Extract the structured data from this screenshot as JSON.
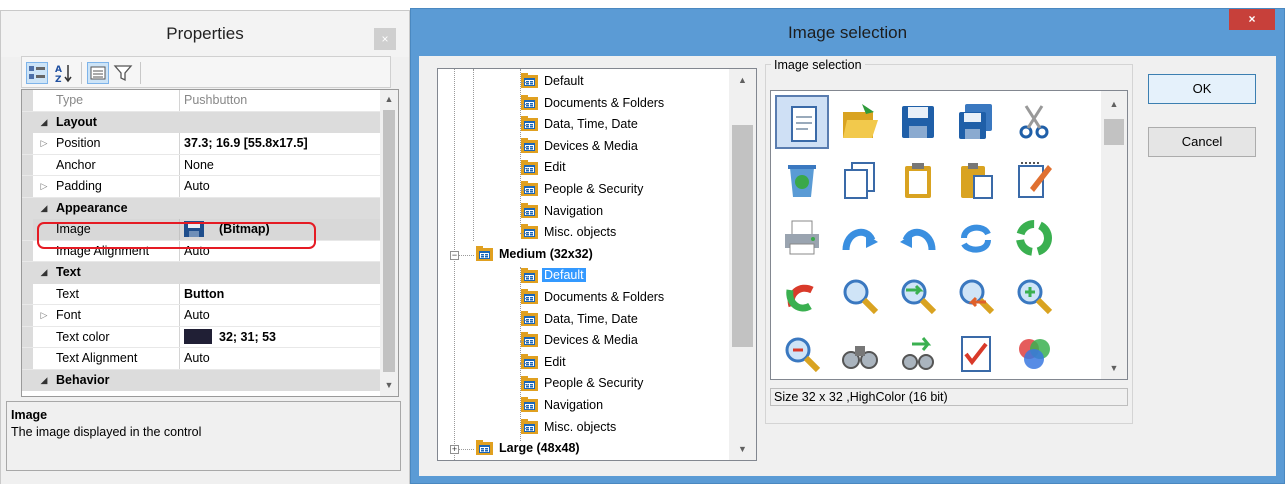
{
  "properties": {
    "title": "Properties",
    "close_glyph": "×",
    "toolbar_icons": [
      "categorized-icon",
      "alphabetical-icon",
      "property-pages-icon",
      "filter-icon"
    ],
    "rows": [
      {
        "kind": "prop",
        "name": "Type",
        "value": "Pushbutton",
        "style": "gray"
      },
      {
        "kind": "cat",
        "name": "Layout"
      },
      {
        "kind": "prop",
        "name": "Position",
        "value": "37.3; 16.9 [55.8x17.5]",
        "expandable": true,
        "style": "bold"
      },
      {
        "kind": "prop",
        "name": "Anchor",
        "value": "None"
      },
      {
        "kind": "prop",
        "name": "Padding",
        "value": "Auto",
        "expandable": true
      },
      {
        "kind": "cat",
        "name": "Appearance"
      },
      {
        "kind": "prop",
        "name": "Image",
        "value": "(Bitmap)",
        "style": "bold",
        "icon": "floppy-disk-icon",
        "selected": true
      },
      {
        "kind": "prop",
        "name": "Image Alignment",
        "value": "Auto"
      },
      {
        "kind": "cat",
        "name": "Text"
      },
      {
        "kind": "prop",
        "name": "Text",
        "value": "Button",
        "style": "bold"
      },
      {
        "kind": "prop",
        "name": "Font",
        "value": "Auto",
        "expandable": true
      },
      {
        "kind": "prop",
        "name": "Text color",
        "value": "32; 31; 53",
        "style": "bold",
        "swatch": "#201f35"
      },
      {
        "kind": "prop",
        "name": "Text Alignment",
        "value": "Auto"
      },
      {
        "kind": "cat",
        "name": "Behavior"
      }
    ],
    "description": {
      "title": "Image",
      "text": "The image displayed in the control"
    }
  },
  "dialog": {
    "title": "Image selection",
    "close_glyph": "×",
    "tree": {
      "items": [
        {
          "label": "Default",
          "level": 1
        },
        {
          "label": "Documents & Folders",
          "level": 1
        },
        {
          "label": "Data, Time, Date",
          "level": 1
        },
        {
          "label": "Devices & Media",
          "level": 1
        },
        {
          "label": "Edit",
          "level": 1
        },
        {
          "label": "People & Security",
          "level": 1
        },
        {
          "label": "Navigation",
          "level": 1
        },
        {
          "label": "Misc. objects",
          "level": 1
        },
        {
          "label": "Medium (32x32)",
          "level": 0,
          "bold": true,
          "toggle": "−"
        },
        {
          "label": "Default",
          "level": 1,
          "selected": true
        },
        {
          "label": "Documents & Folders",
          "level": 1
        },
        {
          "label": "Data, Time, Date",
          "level": 1
        },
        {
          "label": "Devices & Media",
          "level": 1
        },
        {
          "label": "Edit",
          "level": 1
        },
        {
          "label": "People & Security",
          "level": 1
        },
        {
          "label": "Navigation",
          "level": 1
        },
        {
          "label": "Misc. objects",
          "level": 1
        },
        {
          "label": "Large (48x48)",
          "level": 0,
          "bold": true,
          "toggle": "+"
        }
      ]
    },
    "group_label": "Image selection",
    "icons": [
      [
        "document-icon",
        "folder-open-icon",
        "save-icon",
        "save-all-icon",
        "scissors-icon"
      ],
      [
        "recycle-bin-icon",
        "copy-icon",
        "clipboard-icon",
        "paste-icon",
        "edit-notes-icon"
      ],
      [
        "printer-icon",
        "redo-icon",
        "undo-icon",
        "refresh-icon",
        "recycle-icon"
      ],
      [
        "rotate-icon",
        "magnifier-icon",
        "search-next-icon",
        "search-previous-icon",
        "zoom-in-icon"
      ],
      [
        "zoom-out-icon",
        "binoculars-icon",
        "find-next-icon",
        "checklist-icon",
        "color-circles-icon"
      ],
      [
        "misc-icon",
        "misc-icon",
        "misc-icon",
        "misc-icon",
        "misc-icon"
      ]
    ],
    "size_info": "Size 32 x 32 ,HighColor (16 bit)",
    "ok_label": "OK",
    "cancel_label": "Cancel"
  }
}
